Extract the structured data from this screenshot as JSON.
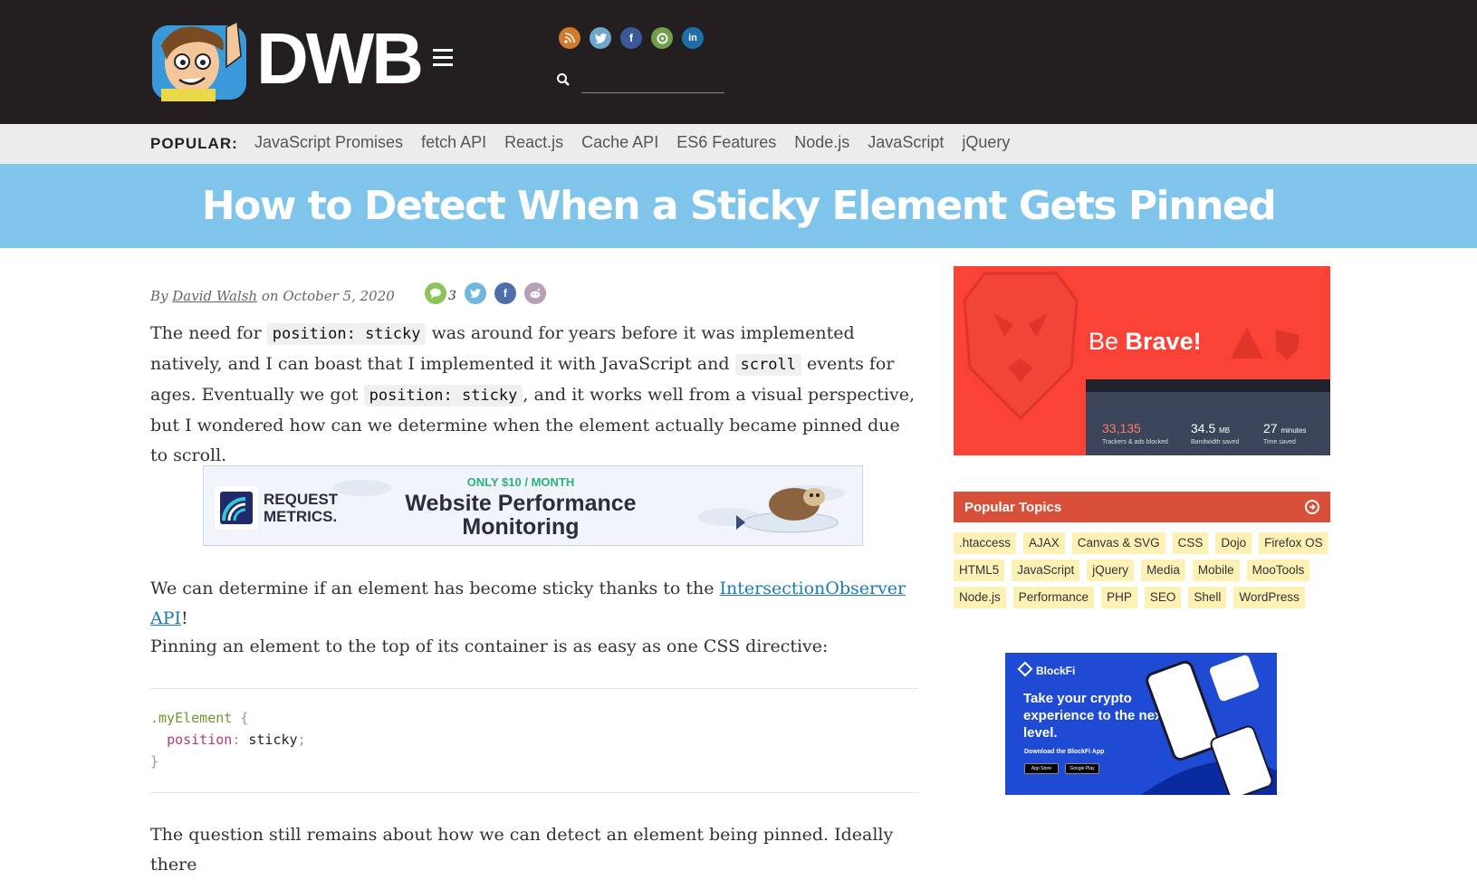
{
  "header": {
    "logo_text": "DWB",
    "search": {
      "value": "",
      "placeholder": ""
    },
    "social_icons": [
      "rss-icon",
      "twitter-icon",
      "facebook-icon",
      "github-icon",
      "linkedin-icon"
    ]
  },
  "popular": {
    "label": "POPULAR:",
    "links": [
      "JavaScript Promises",
      "fetch API",
      "React.js",
      "Cache API",
      "ES6 Features",
      "Node.js",
      "JavaScript",
      "jQuery"
    ]
  },
  "article": {
    "title": "How to Detect When a Sticky Element Gets Pinned",
    "byline_by": "By",
    "author": "David Walsh",
    "byline_on": "on",
    "date": "October 5, 2020",
    "comment_count": "3",
    "para1": {
      "t1": "The need for ",
      "c1": "position: sticky",
      "t2": " was around for years before it was implemented natively, and I can boast that I implemented it with JavaScript and ",
      "c2": "scroll",
      "t3": " events for ages. Eventually we got ",
      "c3": "position: sticky",
      "t4": ", and it works well from a visual perspective, but I wondered how can we determine when the element actually became pinned due to scroll."
    },
    "para2": {
      "t1": "We can determine if an element has become sticky thanks to the ",
      "link": "IntersectionObserver API",
      "t2": "!"
    },
    "para3": "Pinning an element to the top of its container is as easy as one CSS directive:",
    "code": {
      "selector": ".myElement",
      "open": " {",
      "property": "position",
      "colon": ": ",
      "value": "sticky",
      "semi": ";",
      "close": "}"
    },
    "para4": "The question still remains about how we can detect an element being pinned. Ideally there"
  },
  "ads": {
    "request_metrics": {
      "name_line1": "REQUEST",
      "name_line2": "METRICS.",
      "offer": "ONLY $10 / MONTH",
      "headline_line1": "Website Performance",
      "headline_line2": "Monitoring"
    },
    "brave": {
      "be": "Be ",
      "brave": "Brave!",
      "stats": [
        {
          "value": "33,135",
          "unit": "",
          "label": "Trackers & ads blocked"
        },
        {
          "value": "34.5",
          "unit": "MB",
          "label": "Bandwidth saved"
        },
        {
          "value": "27",
          "unit": "minutes",
          "label": "Time saved"
        }
      ]
    },
    "blockfi": {
      "logo": "BlockFi",
      "headline": "Take your crypto experience to the next level.",
      "sub": "Download the BlockFi App",
      "store1": "App Store",
      "store2": "Google Play"
    }
  },
  "sidebar": {
    "topics_title": "Popular Topics",
    "topics": [
      ".htaccess",
      "AJAX",
      "Canvas & SVG",
      "CSS",
      "Dojo",
      "Firefox OS",
      "HTML5",
      "JavaScript",
      "jQuery",
      "Media",
      "Mobile",
      "MooTools",
      "Node.js",
      "Performance",
      "PHP",
      "SEO",
      "Shell",
      "WordPress"
    ]
  },
  "colors": {
    "header_bg": "#231f20",
    "title_bar_bg": "#7fc4eb",
    "topics_header_bg": "#d9503a",
    "topic_tag_bg": "#fdf1b5",
    "brave_bg": "#fb4236",
    "blockfi_bg": "#1f4bd4",
    "link": "#1a7ab8"
  }
}
